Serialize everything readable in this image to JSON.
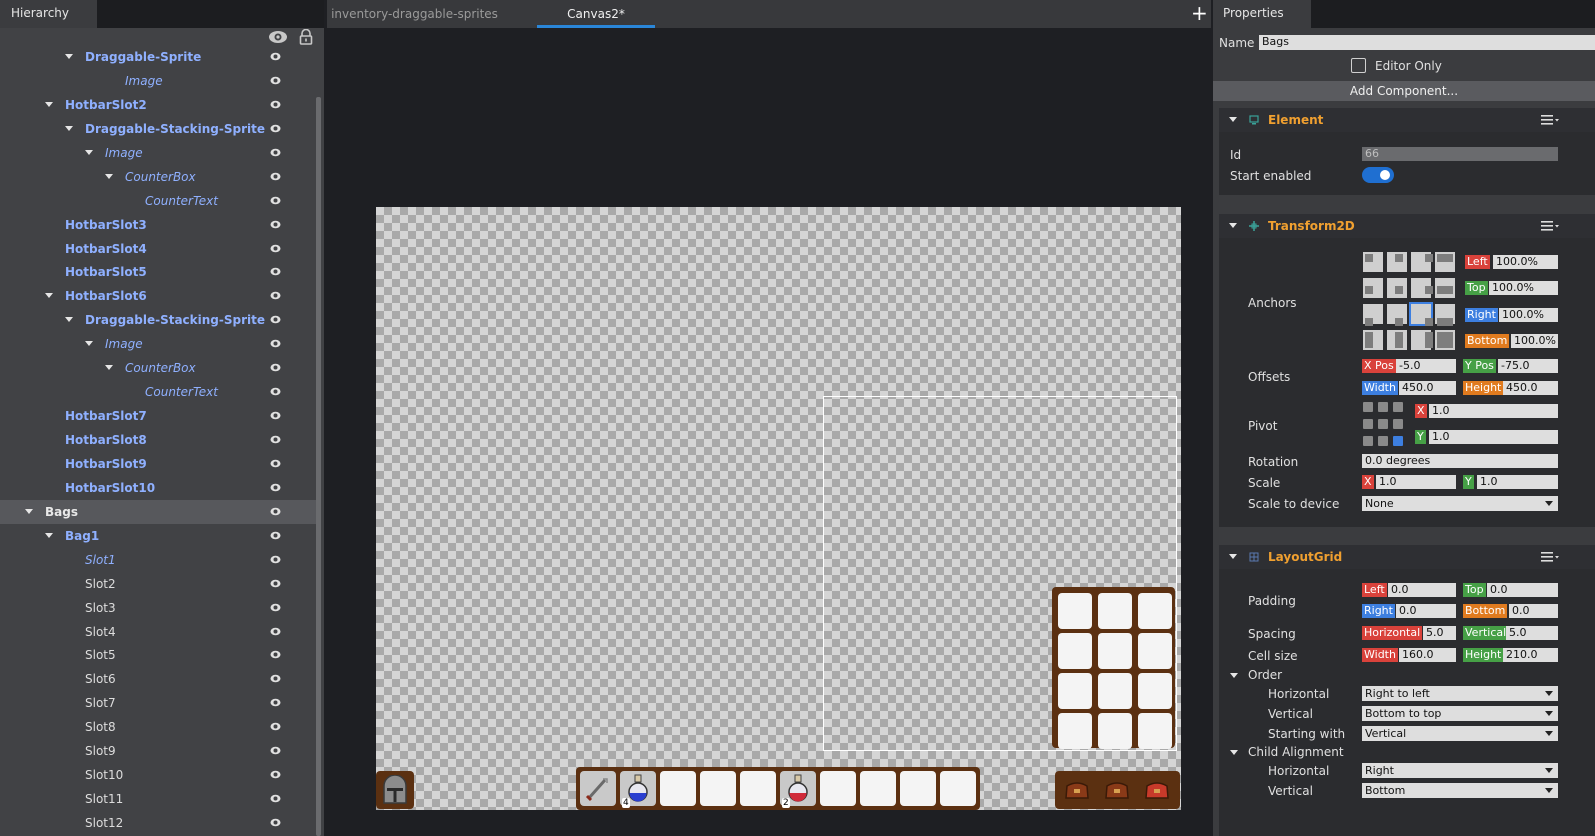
{
  "hierarchy": {
    "title": "Hierarchy",
    "items": [
      {
        "label": "Draggable-Sprite",
        "style": "blue",
        "caret": true
      },
      {
        "label": "Image",
        "style": "italic",
        "caret": false
      },
      {
        "label": "HotbarSlot2",
        "style": "blue",
        "caret": true
      },
      {
        "label": "Draggable-Stacking-Sprite",
        "style": "blue",
        "caret": true
      },
      {
        "label": "Image",
        "style": "italic",
        "caret": true
      },
      {
        "label": "CounterBox",
        "style": "italic",
        "caret": true
      },
      {
        "label": "CounterText",
        "style": "italic",
        "caret": false
      },
      {
        "label": "HotbarSlot3",
        "style": "blue",
        "caret": false
      },
      {
        "label": "HotbarSlot4",
        "style": "blue",
        "caret": false
      },
      {
        "label": "HotbarSlot5",
        "style": "blue",
        "caret": false
      },
      {
        "label": "HotbarSlot6",
        "style": "blue",
        "caret": true
      },
      {
        "label": "Draggable-Stacking-Sprite",
        "style": "blue",
        "caret": true
      },
      {
        "label": "Image",
        "style": "italic",
        "caret": true
      },
      {
        "label": "CounterBox",
        "style": "italic",
        "caret": true
      },
      {
        "label": "CounterText",
        "style": "italic",
        "caret": false
      },
      {
        "label": "HotbarSlot7",
        "style": "blue",
        "caret": false
      },
      {
        "label": "HotbarSlot8",
        "style": "blue",
        "caret": false
      },
      {
        "label": "HotbarSlot9",
        "style": "blue",
        "caret": false
      },
      {
        "label": "HotbarSlot10",
        "style": "blue",
        "caret": false
      },
      {
        "label": "Bags",
        "style": "white",
        "caret": true,
        "selected": true
      },
      {
        "label": "Bag1",
        "style": "blue",
        "caret": true
      },
      {
        "label": "Slot1",
        "style": "italic",
        "caret": false
      },
      {
        "label": "Slot2",
        "style": "plain",
        "caret": false
      },
      {
        "label": "Slot3",
        "style": "plain",
        "caret": false
      },
      {
        "label": "Slot4",
        "style": "plain",
        "caret": false
      },
      {
        "label": "Slot5",
        "style": "plain",
        "caret": false
      },
      {
        "label": "Slot6",
        "style": "plain",
        "caret": false
      },
      {
        "label": "Slot7",
        "style": "plain",
        "caret": false
      },
      {
        "label": "Slot8",
        "style": "plain",
        "caret": false
      },
      {
        "label": "Slot9",
        "style": "plain",
        "caret": false
      },
      {
        "label": "Slot10",
        "style": "plain",
        "caret": false
      },
      {
        "label": "Slot11",
        "style": "plain",
        "caret": false
      },
      {
        "label": "Slot12",
        "style": "plain",
        "caret": false
      }
    ]
  },
  "editor": {
    "tabs": [
      "inventory-draggable-sprites",
      "Canvas2*"
    ],
    "active_tab": "Canvas2*",
    "add_tab_label": "+",
    "hotbar_counts": [
      "4",
      "2"
    ]
  },
  "properties": {
    "title": "Properties",
    "name_label": "Name",
    "name_value": "Bags",
    "editor_only_label": "Editor Only",
    "add_component_label": "Add Component...",
    "element": {
      "title": "Element",
      "id_label": "Id",
      "id_value": "66",
      "start_enabled_label": "Start enabled"
    },
    "transform": {
      "title": "Transform2D",
      "anchors_label": "Anchors",
      "left_tag": "Left",
      "left_value": "100.0%",
      "top_tag": "Top",
      "top_value": "100.0%",
      "right_tag": "Right",
      "right_value": "100.0%",
      "bottom_tag": "Bottom",
      "bottom_value": "100.0%",
      "offsets_label": "Offsets",
      "xpos_tag": "X Pos",
      "xpos_value": "-5.0",
      "ypos_tag": "Y Pos",
      "ypos_value": "-75.0",
      "width_tag": "Width",
      "width_value": "450.0",
      "height_tag": "Height",
      "height_value": "450.0",
      "pivot_label": "Pivot",
      "pivot_x_tag": "X",
      "pivot_x_value": "1.0",
      "pivot_y_tag": "Y",
      "pivot_y_value": "1.0",
      "rotation_label": "Rotation",
      "rotation_value": "0.0 degrees",
      "scale_label": "Scale",
      "scale_x_tag": "X",
      "scale_x_value": "1.0",
      "scale_y_tag": "Y",
      "scale_y_value": "1.0",
      "scale_device_label": "Scale to device",
      "scale_device_value": "None"
    },
    "layout": {
      "title": "LayoutGrid",
      "padding_label": "Padding",
      "p_left_tag": "Left",
      "p_left_value": "0.0",
      "p_top_tag": "Top",
      "p_top_value": "0.0",
      "p_right_tag": "Right",
      "p_right_value": "0.0",
      "p_bottom_tag": "Bottom",
      "p_bottom_value": "0.0",
      "spacing_label": "Spacing",
      "s_h_tag": "Horizontal",
      "s_h_value": "5.0",
      "s_v_tag": "Vertical",
      "s_v_value": "5.0",
      "cell_label": "Cell size",
      "c_w_tag": "Width",
      "c_w_value": "160.0",
      "c_h_tag": "Height",
      "c_h_value": "210.0",
      "order_label": "Order",
      "o_h_label": "Horizontal",
      "o_h_value": "Right to left",
      "o_v_label": "Vertical",
      "o_v_value": "Bottom to top",
      "o_s_label": "Starting with",
      "o_s_value": "Vertical",
      "align_label": "Child Alignment",
      "a_h_label": "Horizontal",
      "a_h_value": "Right",
      "a_v_label": "Vertical",
      "a_v_value": "Bottom"
    }
  },
  "colors": {
    "accent": "#2a86d8",
    "item_name": "#8fb0ff",
    "section_title": "#f0a030",
    "bag_panel": "#5b3011"
  }
}
